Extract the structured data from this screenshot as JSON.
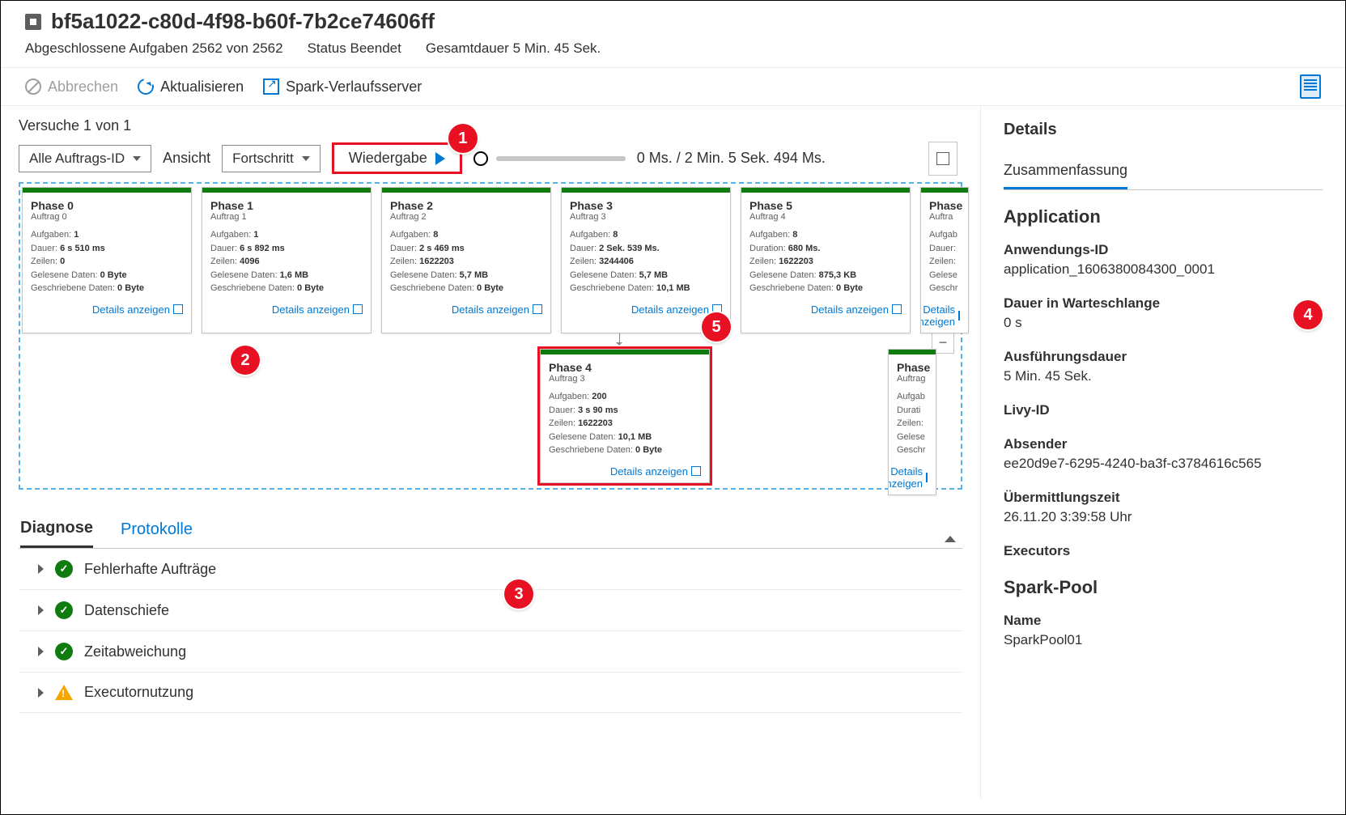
{
  "header": {
    "title": "bf5a1022-c80d-4f98-b60f-7b2ce74606ff",
    "completed_label": "Abgeschlossene Aufgaben",
    "completed_value": "2562 von 2562",
    "status_label": "Status",
    "status_value": "Beendet",
    "duration_label": "Gesamtdauer",
    "duration_value": "5 Min. 45 Sek."
  },
  "toolbar": {
    "cancel": "Abbrechen",
    "refresh": "Aktualisieren",
    "history": "Spark-Verlaufsserver"
  },
  "attempts": "Versuche 1 von 1",
  "controls": {
    "job_filter": "Alle Auftrags-ID",
    "view_label": "Ansicht",
    "view_value": "Fortschritt",
    "playback": "Wiedergabe",
    "timing": "0 Ms. / 2 Min. 5 Sek. 494 Ms."
  },
  "phases": [
    {
      "title": "Phase 0",
      "sub": "Auftrag 0",
      "stats": [
        [
          "Aufgaben:",
          "1"
        ],
        [
          "Dauer:",
          "6 s 510 ms"
        ],
        [
          "Zeilen:",
          "0"
        ],
        [
          "Gelesene Daten:",
          "0 Byte"
        ],
        [
          "Geschriebene Daten:",
          "0 Byte"
        ]
      ]
    },
    {
      "title": "Phase 1",
      "sub": "Auftrag 1",
      "stats": [
        [
          "Aufgaben:",
          "1"
        ],
        [
          "Dauer:",
          "6 s 892 ms"
        ],
        [
          "Zeilen:",
          "4096"
        ],
        [
          "Gelesene Daten:",
          "1,6 MB"
        ],
        [
          "Geschriebene Daten:",
          "0 Byte"
        ]
      ]
    },
    {
      "title": "Phase 2",
      "sub": "Auftrag 2",
      "stats": [
        [
          "Aufgaben:",
          "8"
        ],
        [
          "Dauer:",
          "2 s 469 ms"
        ],
        [
          "Zeilen:",
          "1622203"
        ],
        [
          "Gelesene Daten:",
          "5,7 MB"
        ],
        [
          "Geschriebene Daten:",
          "0 Byte"
        ]
      ]
    },
    {
      "title": "Phase 3",
      "sub": "Auftrag 3",
      "stats": [
        [
          "Aufgaben:",
          "8"
        ],
        [
          "Dauer:",
          "2 Sek. 539 Ms."
        ],
        [
          "Zeilen:",
          "3244406"
        ],
        [
          "Gelesene Daten:",
          "5,7 MB"
        ],
        [
          "Geschriebene Daten:",
          "10,1 MB"
        ]
      ]
    },
    {
      "title": "Phase 5",
      "sub": "Auftrag 4",
      "stats": [
        [
          "Aufgaben:",
          "8"
        ],
        [
          "Duration:",
          "680 Ms."
        ],
        [
          "Zeilen:",
          "1622203"
        ],
        [
          "Gelesene Daten:",
          "875,3 KB"
        ],
        [
          "Geschriebene Daten:",
          "0 Byte"
        ]
      ]
    },
    {
      "title": "Phase",
      "sub": "Auftra",
      "stats": [
        [
          "Aufgab",
          ""
        ],
        [
          "Dauer:",
          ""
        ],
        [
          "Zeilen:",
          ""
        ],
        [
          "Gelese",
          ""
        ],
        [
          "Geschr",
          ""
        ]
      ]
    },
    {
      "title": "Phase 4",
      "sub": "Auftrag 3",
      "stats": [
        [
          "Aufgaben:",
          "200"
        ],
        [
          "Dauer:",
          "3 s 90 ms"
        ],
        [
          "Zeilen:",
          "1622203"
        ],
        [
          "Gelesene Daten:",
          "10,1 MB"
        ],
        [
          "Geschriebene Daten:",
          "0 Byte"
        ]
      ]
    },
    {
      "title": "Phase",
      "sub": "Auftrag",
      "stats": [
        [
          "Aufgab",
          ""
        ],
        [
          "Durati",
          ""
        ],
        [
          "Zeilen:",
          ""
        ],
        [
          "Gelese",
          ""
        ],
        [
          "Geschr",
          ""
        ]
      ]
    }
  ],
  "details_link": "Details anzeigen",
  "lower_tabs": {
    "diag": "Diagnose",
    "logs": "Protokolle"
  },
  "diag_items": [
    {
      "icon": "ok",
      "label": "Fehlerhafte Aufträge"
    },
    {
      "icon": "ok",
      "label": "Datenschiefe"
    },
    {
      "icon": "ok",
      "label": "Zeitabweichung"
    },
    {
      "icon": "warn",
      "label": "Executornutzung"
    }
  ],
  "right": {
    "title": "Details",
    "tab": "Zusammenfassung",
    "app_section": "Application",
    "fields": [
      {
        "lbl": "Anwendungs-ID",
        "val": "application_1606380084300_0001"
      },
      {
        "lbl": "Dauer in Warteschlange",
        "val": "0 s"
      },
      {
        "lbl": "Ausführungsdauer",
        "val": "5 Min. 45 Sek."
      },
      {
        "lbl": "Livy-ID",
        "val": ""
      },
      {
        "lbl": "Absender",
        "val": "ee20d9e7-6295-4240-ba3f-c3784616c565"
      },
      {
        "lbl": "Übermittlungszeit",
        "val": "26.11.20 3:39:58 Uhr"
      },
      {
        "lbl": "Executors",
        "val": ""
      }
    ],
    "pool_section": "Spark-Pool",
    "pool_fields": [
      {
        "lbl": "Name",
        "val": "SparkPool01"
      }
    ]
  },
  "callouts": {
    "1": "1",
    "2": "2",
    "3": "3",
    "4": "4",
    "5": "5"
  }
}
